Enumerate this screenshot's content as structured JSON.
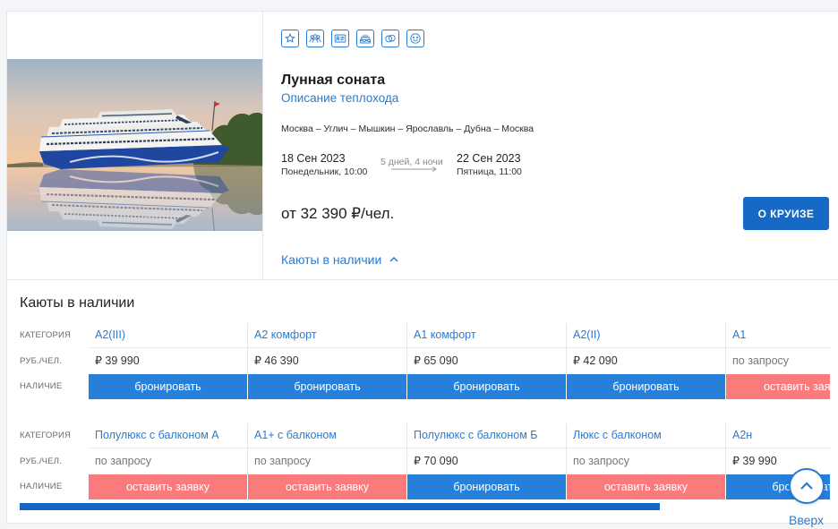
{
  "features": {
    "icons": [
      "star-icon",
      "group-icon",
      "id-card-icon",
      "cake-icon",
      "rings-icon",
      "smile-icon"
    ]
  },
  "cruise": {
    "title": "Лунная соната",
    "ship_link": "Описание теплохода",
    "route": "Москва – Углич – Мышкин – Ярославль – Дубна – Москва",
    "departure": {
      "date": "18 Сен 2023",
      "day_time": "Понедельник, 10:00"
    },
    "duration": "5 дней, 4 ночи",
    "arrival": {
      "date": "22 Сен 2023",
      "day_time": "Пятница, 11:00"
    },
    "price": "от 32 390 ₽/чел.",
    "about_button": "О КРУИЗЕ",
    "cabins_toggle": "Каюты в наличии"
  },
  "cabins": {
    "heading": "Каюты в наличии",
    "row_labels": {
      "category": "КАТЕГОРИЯ",
      "price": "РУБ./ЧЕЛ.",
      "availability": "НАЛИЧИЕ"
    },
    "tables": [
      {
        "columns": [
          {
            "category": "A2(III)",
            "price": "₽ 39 990",
            "price_color": "#333333",
            "action": "бронировать",
            "action_color": "#2680da"
          },
          {
            "category": "A2 комфорт",
            "price": "₽ 46 390",
            "price_color": "#333333",
            "action": "бронировать",
            "action_color": "#2680da"
          },
          {
            "category": "A1 комфорт",
            "price": "₽ 65 090",
            "price_color": "#333333",
            "action": "бронировать",
            "action_color": "#2680da"
          },
          {
            "category": "A2(II)",
            "price": "₽ 42 090",
            "price_color": "#333333",
            "action": "бронировать",
            "action_color": "#2680da"
          },
          {
            "category": "A1",
            "price": "по запросу",
            "price_color": "#777777",
            "action": "оставить заявку",
            "action_color": "#fb7a7c"
          }
        ]
      },
      {
        "columns": [
          {
            "category": "Полулюкс с балконом А",
            "price": "по запросу",
            "price_color": "#777777",
            "action": "оставить заявку",
            "action_color": "#fb7a7c"
          },
          {
            "category": "А1+ с балконом",
            "price": "по запросу",
            "price_color": "#777777",
            "action": "оставить заявку",
            "action_color": "#fb7a7c"
          },
          {
            "category": "Полулюкс с балконом Б",
            "price": "₽ 70 090",
            "price_color": "#333333",
            "action": "бронировать",
            "action_color": "#2680da"
          },
          {
            "category": "Люкс с балконом",
            "price": "по запросу",
            "price_color": "#777777",
            "action": "оставить заявку",
            "action_color": "#fb7a7c"
          },
          {
            "category": "А2н",
            "price": "₽ 39 990",
            "price_color": "#333333",
            "action": "бронировать",
            "action_color": "#2680da"
          }
        ]
      }
    ]
  },
  "back_to_top": {
    "label": "Вверх"
  },
  "colors": {
    "link": "#2a7bcf",
    "primary_button": "#1769c6",
    "scrollbar": "#1763c2",
    "border": "#e3e6ea"
  }
}
